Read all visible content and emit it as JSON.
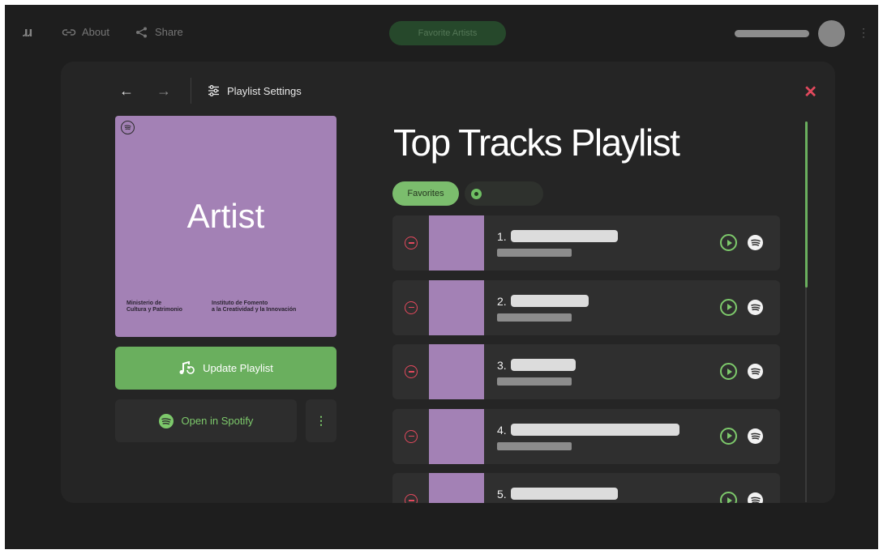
{
  "topbar": {
    "logo": "ɹɹ",
    "about_label": "About",
    "share_label": "Share",
    "favorite_artists_label": "Favorite Artists",
    "link_icon": "link-icon",
    "share_icon": "share-icon"
  },
  "modal": {
    "settings_label": "Playlist Settings",
    "close_glyph": "✕",
    "back_glyph": "←",
    "forward_glyph": "→"
  },
  "cover": {
    "title": "Artist",
    "footer_left": "Ministerio de\nCultura y Patrimonio",
    "footer_right": "Instituto de Fomento\na la Creatividad y la Innovación"
  },
  "actions": {
    "update_label": "Update Playlist",
    "open_spotify_label": "Open in Spotify",
    "more_glyph": "⋮"
  },
  "playlist": {
    "title": "Top Tracks Playlist",
    "filter_favorites": "Favorites"
  },
  "tracks": [
    {
      "number": "1."
    },
    {
      "number": "2."
    },
    {
      "number": "3."
    },
    {
      "number": "4."
    },
    {
      "number": "5."
    }
  ],
  "colors": {
    "accent_green": "#6aaf5e",
    "cover_purple": "#a381b5",
    "remove_red": "#e2495d",
    "background": "#1e1e1e"
  }
}
